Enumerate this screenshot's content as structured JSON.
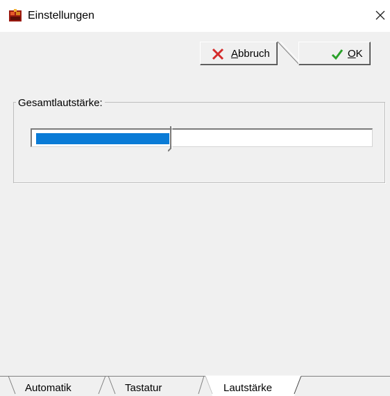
{
  "window": {
    "title": "Einstellungen"
  },
  "toolbar": {
    "cancel": {
      "label_prefix": "",
      "mnemonic": "A",
      "label_rest": "bbruch"
    },
    "ok": {
      "mnemonic": "O",
      "label_rest": "K"
    }
  },
  "volume_group": {
    "label": "Gesamtlautstärke:",
    "level_percent": 40
  },
  "tabs": [
    {
      "label": "Automatik",
      "active": false
    },
    {
      "label": "Tastatur",
      "active": false
    },
    {
      "label": "Lautstärke",
      "active": true
    }
  ],
  "colors": {
    "accent": "#0a7bd6",
    "cancel_icon": "#d42b2b",
    "ok_icon": "#2aa12a"
  },
  "icons": {
    "app": "app-icon",
    "close": "close-icon",
    "cancel": "x-icon",
    "ok": "checkmark-icon"
  }
}
